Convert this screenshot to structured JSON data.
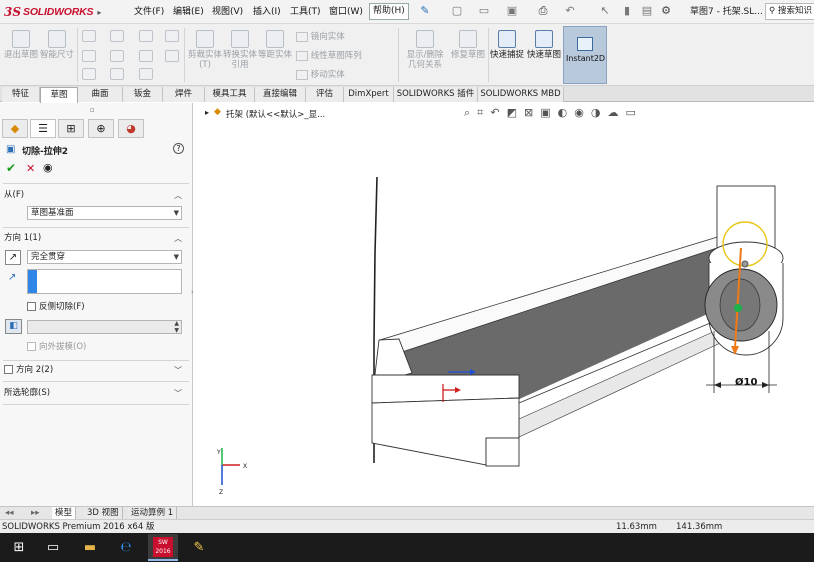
{
  "app": {
    "logo_ds": "3S",
    "logo_text": "SOLIDWORKS",
    "window_title": "草图7 - 托架.SL...",
    "search_placeholder": "搜索知识"
  },
  "menu": {
    "items": [
      "文件(F)",
      "编辑(E)",
      "视图(V)",
      "插入(I)",
      "工具(T)",
      "窗口(W)"
    ],
    "help": "帮助(H)"
  },
  "ribbon": {
    "exit_sketch": "退出草图",
    "smart_dimension": "智能尺寸",
    "trim_entities": "剪裁实体(T)",
    "convert_entities": "转换实体引用",
    "offset_entities": "等距实体",
    "mirror_entities": "镜向实体",
    "linear_pattern": "线性草图阵列",
    "move_entities": "移动实体",
    "display_relations": "显示/删除几何关系",
    "repair_sketch": "修复草图",
    "quick_snaps": "快速捕捉",
    "rapid_sketch": "快速草图",
    "instant2d": "Instant2D"
  },
  "tabs": [
    "特征",
    "草图",
    "曲面",
    "钣金",
    "焊件",
    "模具工具",
    "直接编辑",
    "评估",
    "DimXpert",
    "SOLIDWORKS 插件",
    "SOLIDWORKS MBD"
  ],
  "active_tab": "草图",
  "feature_panel": {
    "title": "切除-拉伸2",
    "help_icon": "?",
    "from_label": "从(F)",
    "from_value": "草图基准面",
    "direction1_label": "方向 1(1)",
    "end_condition": "完全贯穿",
    "flip_side_label": "反侧切除(F)",
    "draft_outward_label": "向外拔模(O)",
    "direction2_label": "方向 2(2)",
    "selected_contours_label": "所选轮廓(S)"
  },
  "viewport": {
    "breadcrumb": "托架 (默认<<默认>_显...",
    "dimension_label": "Ø10",
    "triad_y": "Y",
    "triad_z": "Z",
    "triad_x": "X"
  },
  "bottom_tabs": [
    "模型",
    "3D 视图",
    "运动算例 1"
  ],
  "active_bottom_tab": "模型",
  "status": {
    "product": "SOLIDWORKS Premium 2016 x64 版",
    "coord_x": "11.63mm",
    "coord_y": "141.36mm"
  },
  "taskbar": {
    "sw_badge": "2016"
  },
  "colors": {
    "accent_red": "#c8102e",
    "sketch_yellow": "#e6c619",
    "sketch_orange": "#f07a18",
    "sketch_green": "#1db34a",
    "ok_green": "#1a9a1a",
    "cancel_red": "#c8102e"
  }
}
